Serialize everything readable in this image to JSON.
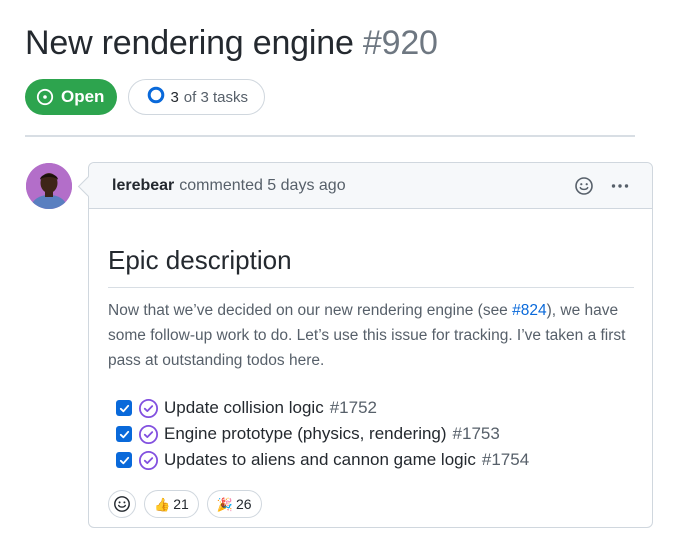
{
  "issue": {
    "title": "New rendering engine",
    "number": "#920",
    "state": "Open",
    "tasks_done": "3",
    "tasks_rest": "of 3 tasks"
  },
  "comment": {
    "author": "lerebear",
    "meta": "commented 5 days ago",
    "icons": [
      "smiley-icon",
      "kebab-menu-icon"
    ]
  },
  "body": {
    "heading": "Epic description",
    "para_before": "Now that we’ve decided on our new rendering engine (see ",
    "para_link": "#824",
    "para_after": "), we have some follow-up work to do. Let’s use this issue for tracking. I’ve taken a first pass at outstanding todos here.",
    "tasks": [
      {
        "title": "Update collision logic",
        "ref": "#1752",
        "checked": true
      },
      {
        "title": "Engine prototype (physics, rendering)",
        "ref": "#1753",
        "checked": true
      },
      {
        "title": "Updates to aliens and cannon game logic",
        "ref": "#1754",
        "checked": true
      }
    ]
  },
  "reactions": [
    {
      "emoji": "👍",
      "count": "21"
    },
    {
      "emoji": "🎉",
      "count": "26"
    }
  ],
  "colors": {
    "open_green": "#2da44e",
    "link_blue": "#0969da",
    "closed_purple": "#8250df",
    "muted": "#57606a"
  }
}
